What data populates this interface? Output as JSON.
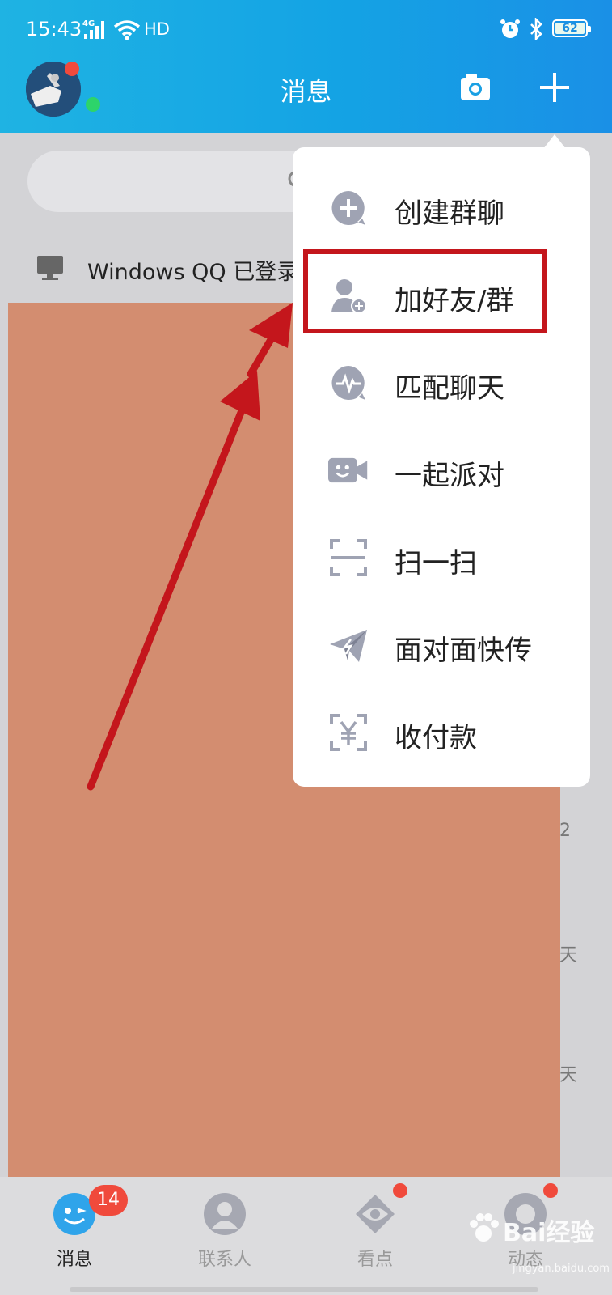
{
  "status_bar": {
    "time": "15:43",
    "network": "4G",
    "hd": "HD",
    "battery": "62"
  },
  "header": {
    "title": "消息"
  },
  "background": {
    "pc_login": "Windows QQ 已登录",
    "right_times": [
      "2",
      "天",
      "天"
    ]
  },
  "menu": {
    "items": [
      {
        "label": "创建群聊",
        "icon": "plus-bubble-icon"
      },
      {
        "label": "加好友/群",
        "icon": "add-friend-icon"
      },
      {
        "label": "匹配聊天",
        "icon": "match-chat-icon"
      },
      {
        "label": "一起派对",
        "icon": "party-camera-icon"
      },
      {
        "label": "扫一扫",
        "icon": "scan-icon"
      },
      {
        "label": "面对面快传",
        "icon": "paper-plane-icon"
      },
      {
        "label": "收付款",
        "icon": "payment-icon"
      }
    ],
    "highlighted_index": 1
  },
  "bottom_nav": {
    "items": [
      {
        "label": "消息",
        "active": true
      },
      {
        "label": "联系人",
        "active": false
      },
      {
        "label": "看点",
        "active": false
      },
      {
        "label": "动态",
        "active": false
      }
    ],
    "messages_badge": "14"
  },
  "watermark": {
    "text": "Bai经验",
    "sub": "jingyan.baidu.com"
  },
  "colors": {
    "header_blue": "#14a3e4",
    "highlight_red": "#c4161c",
    "badge_red": "#f04a3c",
    "redaction": "#d38d70"
  }
}
